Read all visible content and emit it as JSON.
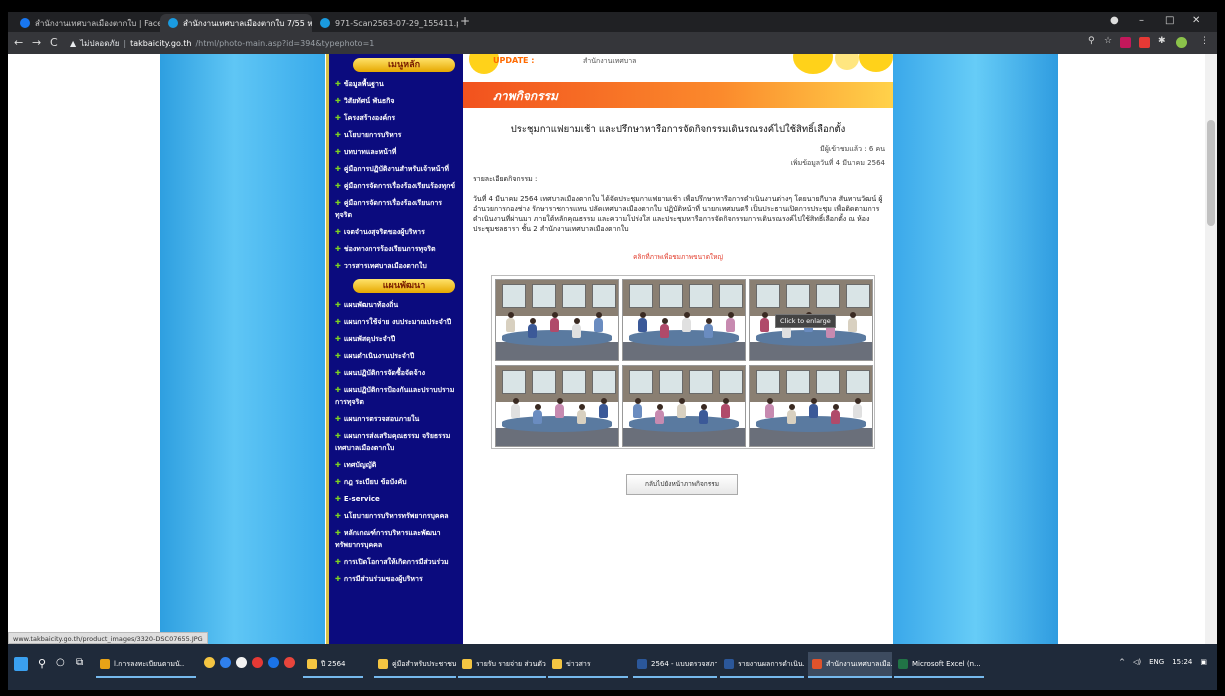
{
  "browser": {
    "tabs": [
      {
        "title": "สำนักงานเทศบาลเมืองตากใบ | Facebo",
        "active": false,
        "favicon_color": "#1877f2"
      },
      {
        "title": "สำนักงานเทศบาลเมืองตากใบ 7/55 ห.",
        "active": true,
        "favicon_color": "#1a9be0"
      },
      {
        "title": "971-Scan2563-07-29_155411.pdf",
        "active": false,
        "favicon_color": "#1a9be0"
      }
    ],
    "new_tab_glyph": "+",
    "window_controls": {
      "minimize": "–",
      "maximize": "□",
      "close": "✕"
    },
    "nav": {
      "back": "←",
      "forward": "→",
      "reload": "C"
    },
    "security_label": "ไม่ปลอดภัย",
    "url_domain": "takbaicity.go.th",
    "url_path": "/html/photo-main.asp?id=394&typephoto=1"
  },
  "site": {
    "update_label": "UPDATE :",
    "update_text": "สำนักงานเทศบาล",
    "menus": [
      {
        "header": "เมนูหลัก",
        "items": [
          "ข้อมูลพื้นฐาน",
          "วิสัยทัศน์ พันธกิจ",
          "โครงสร้างองค์กร",
          "นโยบายการบริหาร",
          "บทบาทและหน้าที่",
          "คู่มือการปฏิบัติงานสำหรับเจ้าหน้าที่",
          "คู่มือการจัดการเรื่องร้องเรียนร้องทุกข์",
          "คู่มือการจัดการเรื่องร้องเรียนการทุจริต",
          "เจตจำนงสุจริตของผู้บริหาร",
          "ช่องทางการร้องเรียนการทุจริต",
          "วารสารเทศบาลเมืองตากใบ"
        ]
      },
      {
        "header": "แผนพัฒนา",
        "items": [
          "แผนพัฒนาท้องถิ่น",
          "แผนการใช้จ่าย งบประมาณประจำปี",
          "แผนพัสดุประจำปี",
          "แผนดำเนินงานประจำปี",
          "แผนปฏิบัติการจัดซื้อจัดจ้าง",
          "แผนปฏิบัติการป้องกันและปราบปรามการทุจริต",
          "แผนการตรวจสอบภายใน",
          "แผนการส่งเสริมคุณธรรม จริยธรรมเทศบาลเมืองตากใบ",
          "เทศบัญญัติ",
          "กฎ ระเบียบ ข้อบังคับ",
          "E-service",
          "นโยบายการบริหารทรัพยากรบุคคล",
          "หลักเกณฑ์การบริหารและพัฒนาทรัพยากรบุคคล",
          "การเปิดโอกาสให้เกิดการมีส่วนร่วม",
          "การมีส่วนร่วมของผู้บริหาร"
        ]
      }
    ],
    "activity": {
      "banner_title": "ภาพกิจกรรม",
      "headline": "ประชุมกาแฟยามเช้า และปรึกษาหารือการจัดกิจกรรมเดินรณรงค์ไปใช้สิทธิ์เลือกตั้ง",
      "views": "มีผู้เข้าชมแล้ว : 6 คน",
      "posted": "เพิ่มข้อมูลวันที่ 4 มีนาคม 2564",
      "detail_label": "รายละเอียดกิจกรรม :",
      "detail": "วันที่ 4 มีนาคม 2564 เทศบาลเมืองตากใบ ได้จัดประชุมกาแฟยามเช้า เพื่อปรึกษาหารือการดำเนินงานต่างๆ โดยนายกีบาล สันทานวัฒน์ ผู้อำนวยการกองช่าง รักษาราชการแทน ปลัดเทศบาลเมืองตากใบ ปฏิบัติหน้าที่ นายกเทศมนตรี เป็นประธานเปิดการประชุม เพื่อติดตามการดำเนินงานที่ผ่านมา ภายใต้หลักคุณธรรม และความโปร่งใส และประชุมหารือการจัดกิจกรรมการเดินรณรงค์ไปใช้สิทธิ์เลือกตั้ง ณ ห้องประชุมชลธารา ชั้น 2 สำนักงานเทศบาลเมืองตากใบ",
      "enlarge_note": "คลิกที่ภาพเพื่อชมภาพขนาดใหญ่",
      "tooltip": "Click to enlarge",
      "back_button": "กลับไปยังหน้าภาพกิจกรรม",
      "photo_count": 6
    }
  },
  "status_url": "www.takbaicity.go.th/product_images/3320-DSC07655.JPG",
  "taskbar": {
    "items": [
      {
        "label": "l.การลงทะเบียนตามนั..",
        "color": "#e8a317",
        "state": "open"
      },
      {
        "label": "ปี 2564",
        "color": "#f4c542",
        "state": "open"
      },
      {
        "label": "คู่มือสำหรับประชาชน ...",
        "color": "#f4c542",
        "state": "open"
      },
      {
        "label": "รายรับ รายจ่าย ส่วนตัว",
        "color": "#f4c542",
        "state": "open"
      },
      {
        "label": "ข่าวสาร",
        "color": "#f4c542",
        "state": "open"
      },
      {
        "label": "2564 - แบบตรวจสภาพ...",
        "color": "#2b579a",
        "state": "open"
      },
      {
        "label": "รายงานผลการดำเนิน...",
        "color": "#2b579a",
        "state": "open"
      },
      {
        "label": "สำนักงานเทศบาลเมือ...",
        "color": "#e0532b",
        "state": "active"
      },
      {
        "label": "Microsoft Excel (n...",
        "color": "#217346",
        "state": "open"
      }
    ],
    "tray_lang": "ENG",
    "tray_time": "15:24"
  },
  "colors": {
    "sidebar_bg": "#0b0b7e",
    "banner": "#f2521e",
    "sky": "#38aaeb"
  }
}
